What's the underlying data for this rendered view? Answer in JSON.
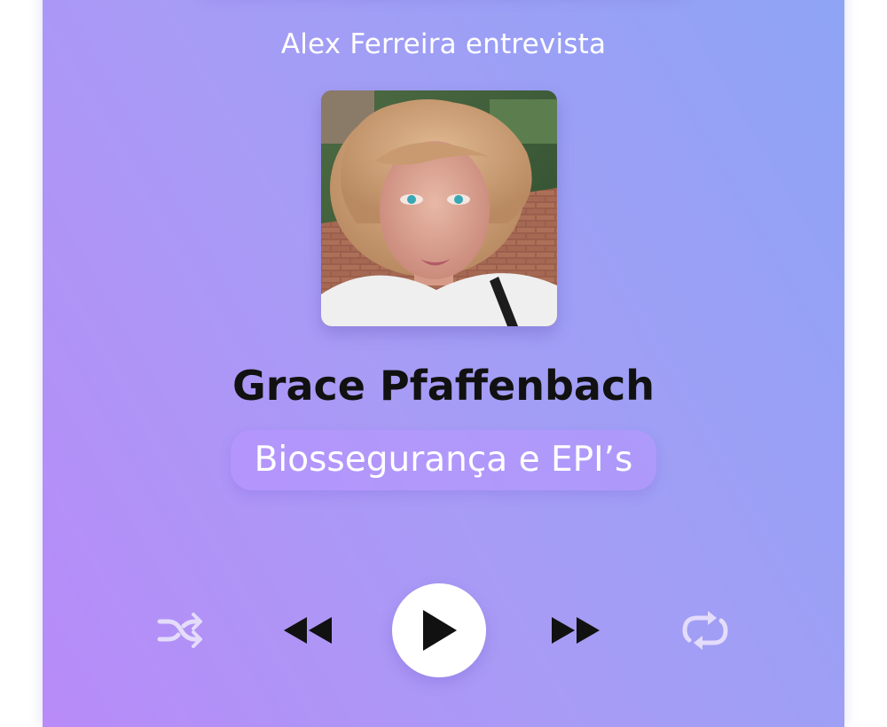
{
  "player": {
    "header_subtitle": "Alex Ferreira entrevista",
    "guest_name": "Grace Pfaffenbach",
    "topic": "Biossegurança e EPI’s",
    "photo": "guest-portrait-photo"
  },
  "controls": {
    "shuffle": "shuffle-icon",
    "rewind": "rewind-icon",
    "play": "play-icon",
    "forward": "fast-forward-icon",
    "repeat": "repeat-icon"
  },
  "colors": {
    "gradient_start": "#b88bf8",
    "gradient_end": "#8ea4f5",
    "name_text": "#111111",
    "light_text": "#ffffff",
    "inactive_icon": "#e4dcfb",
    "active_icon": "#111111"
  }
}
